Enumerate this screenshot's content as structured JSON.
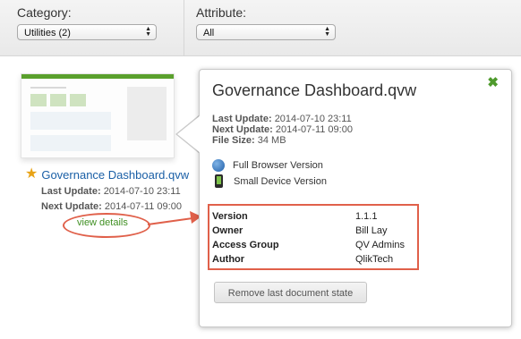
{
  "filters": {
    "category_label": "Category:",
    "category_value": "Utilities (2)",
    "attribute_label": "Attribute:",
    "attribute_value": "All"
  },
  "document": {
    "title": "Governance Dashboard.qvw",
    "last_update_label": "Last Update:",
    "last_update": "2014-07-10 23:11",
    "next_update_label": "Next Update:",
    "next_update": "2014-07-11 09:00",
    "view_details": "view details"
  },
  "popup": {
    "title": "Governance Dashboard.qvw",
    "last_update_label": "Last Update:",
    "last_update": "2014-07-10 23:11",
    "next_update_label": "Next Update:",
    "next_update": "2014-07-11 09:00",
    "file_size_label": "File Size:",
    "file_size": "34 MB",
    "versions": [
      {
        "label": "Full Browser Version",
        "icon": "globe-icon"
      },
      {
        "label": "Small Device Version",
        "icon": "phone-icon"
      }
    ],
    "info": [
      {
        "key": "Version",
        "value": "1.1.1"
      },
      {
        "key": "Owner",
        "value": "Bill Lay"
      },
      {
        "key": "Access Group",
        "value": "QV Admins"
      },
      {
        "key": "Author",
        "value": "QlikTech"
      }
    ],
    "remove_button": "Remove last document state",
    "close_glyph": "✖"
  },
  "colors": {
    "link_blue": "#1a5fa6",
    "accent_green": "#4e9a2c",
    "highlight_red": "#e0604a"
  }
}
